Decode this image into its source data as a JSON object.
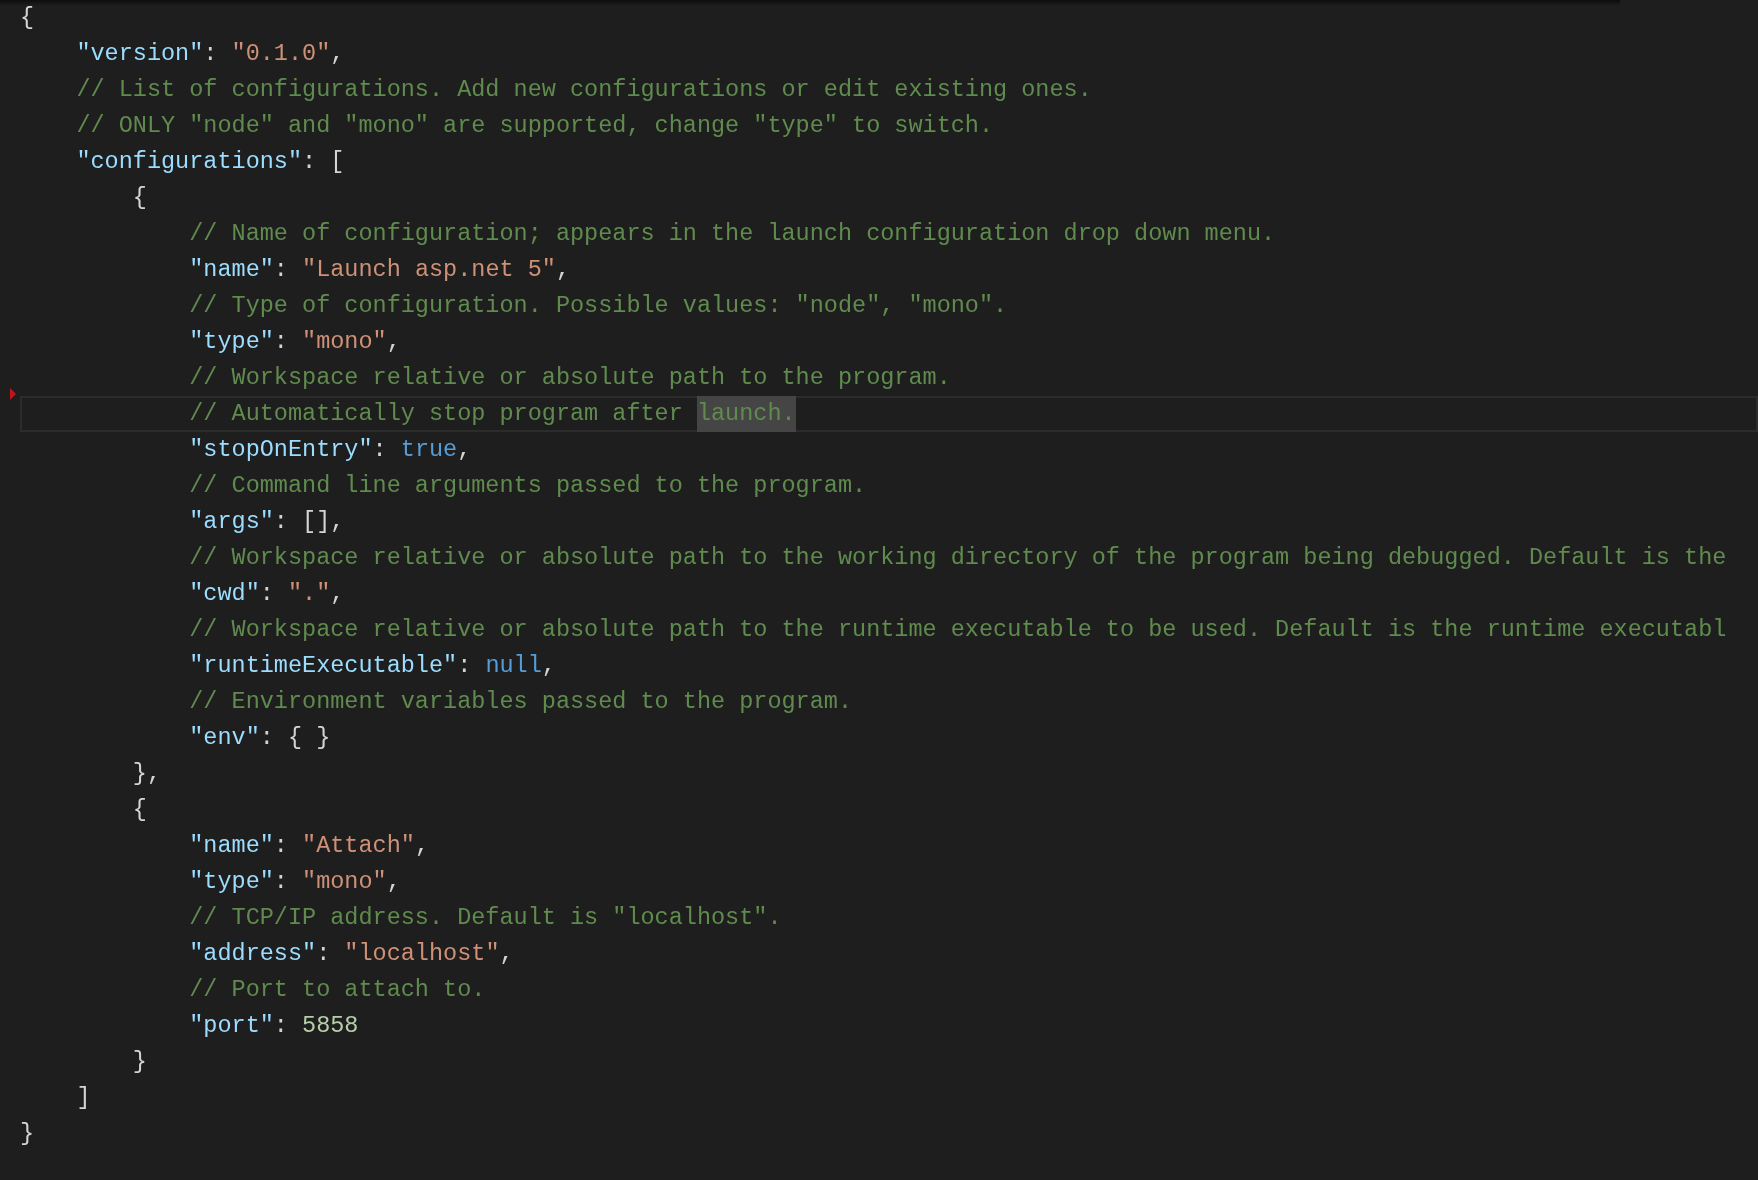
{
  "editor": {
    "lines": [
      {
        "current": false,
        "marker": false,
        "tokens": [
          {
            "kind": "punct",
            "text": "{",
            "highlighted": false
          }
        ],
        "children": [
          {
            "current": false,
            "marker": false,
            "tokens": [
              {
                "kind": "key",
                "text": "\"version\"",
                "highlighted": false
              },
              {
                "kind": "punct",
                "text": ": ",
                "highlighted": false
              },
              {
                "kind": "string",
                "text": "\"0.1.0\"",
                "highlighted": false
              },
              {
                "kind": "punct",
                "text": ",",
                "highlighted": false
              }
            ]
          },
          {
            "current": false,
            "marker": false,
            "tokens": [
              {
                "kind": "comment",
                "text": "// List of configurations. Add new configurations or edit existing ones.",
                "highlighted": false
              }
            ]
          },
          {
            "current": false,
            "marker": false,
            "tokens": [
              {
                "kind": "comment",
                "text": "// ONLY \"node\" and \"mono\" are supported, change \"type\" to switch.",
                "highlighted": false
              }
            ]
          },
          {
            "current": false,
            "marker": false,
            "tokens": [
              {
                "kind": "key",
                "text": "\"configurations\"",
                "highlighted": false
              },
              {
                "kind": "punct",
                "text": ": [",
                "highlighted": false
              }
            ],
            "children": [
              {
                "current": false,
                "marker": false,
                "tokens": [
                  {
                    "kind": "punct",
                    "text": "{",
                    "highlighted": false
                  }
                ],
                "children": [
                  {
                    "current": false,
                    "marker": false,
                    "tokens": [
                      {
                        "kind": "comment",
                        "text": "// Name of configuration; appears in the launch configuration drop down menu.",
                        "highlighted": false
                      }
                    ]
                  },
                  {
                    "current": false,
                    "marker": false,
                    "tokens": [
                      {
                        "kind": "key",
                        "text": "\"name\"",
                        "highlighted": false
                      },
                      {
                        "kind": "punct",
                        "text": ": ",
                        "highlighted": false
                      },
                      {
                        "kind": "string",
                        "text": "\"Launch asp.net 5\"",
                        "highlighted": false
                      },
                      {
                        "kind": "punct",
                        "text": ",",
                        "highlighted": false
                      }
                    ]
                  },
                  {
                    "current": false,
                    "marker": false,
                    "tokens": [
                      {
                        "kind": "comment",
                        "text": "// Type of configuration. Possible values: \"node\", \"mono\".",
                        "highlighted": false
                      }
                    ]
                  },
                  {
                    "current": false,
                    "marker": false,
                    "tokens": [
                      {
                        "kind": "key",
                        "text": "\"type\"",
                        "highlighted": false
                      },
                      {
                        "kind": "punct",
                        "text": ": ",
                        "highlighted": false
                      },
                      {
                        "kind": "string",
                        "text": "\"mono\"",
                        "highlighted": false
                      },
                      {
                        "kind": "punct",
                        "text": ",",
                        "highlighted": false
                      }
                    ]
                  },
                  {
                    "current": false,
                    "marker": false,
                    "tokens": [
                      {
                        "kind": "comment",
                        "text": "// Workspace relative or absolute path to the program.",
                        "highlighted": false
                      }
                    ]
                  },
                  {
                    "current": true,
                    "marker": true,
                    "tokens": [
                      {
                        "kind": "comment",
                        "text": "// Automatically stop program after",
                        "highlighted": false
                      },
                      {
                        "kind": "comment",
                        "text": "launch.",
                        "highlighted": true
                      }
                    ]
                  },
                  {
                    "current": false,
                    "marker": false,
                    "tokens": [
                      {
                        "kind": "key",
                        "text": "\"stopOnEntry\"",
                        "highlighted": false
                      },
                      {
                        "kind": "punct",
                        "text": ": ",
                        "highlighted": false
                      },
                      {
                        "kind": "keyword",
                        "text": "true",
                        "highlighted": false
                      },
                      {
                        "kind": "punct",
                        "text": ",",
                        "highlighted": false
                      }
                    ]
                  },
                  {
                    "current": false,
                    "marker": false,
                    "tokens": [
                      {
                        "kind": "comment",
                        "text": "// Command line arguments passed to the program.",
                        "highlighted": false
                      }
                    ]
                  },
                  {
                    "current": false,
                    "marker": false,
                    "tokens": [
                      {
                        "kind": "key",
                        "text": "\"args\"",
                        "highlighted": false
                      },
                      {
                        "kind": "punct",
                        "text": ": [],",
                        "highlighted": false
                      }
                    ]
                  },
                  {
                    "current": false,
                    "marker": false,
                    "tokens": [
                      {
                        "kind": "comment",
                        "text": "// Workspace relative or absolute path to the working directory of the program being debugged. Default is the",
                        "highlighted": false
                      }
                    ]
                  },
                  {
                    "current": false,
                    "marker": false,
                    "tokens": [
                      {
                        "kind": "key",
                        "text": "\"cwd\"",
                        "highlighted": false
                      },
                      {
                        "kind": "punct",
                        "text": ": ",
                        "highlighted": false
                      },
                      {
                        "kind": "string",
                        "text": "\".\"",
                        "highlighted": false
                      },
                      {
                        "kind": "punct",
                        "text": ",",
                        "highlighted": false
                      }
                    ]
                  },
                  {
                    "current": false,
                    "marker": false,
                    "tokens": [
                      {
                        "kind": "comment",
                        "text": "// Workspace relative or absolute path to the runtime executable to be used. Default is the runtime executabl",
                        "highlighted": false
                      }
                    ]
                  },
                  {
                    "current": false,
                    "marker": false,
                    "tokens": [
                      {
                        "kind": "key",
                        "text": "\"runtimeExecutable\"",
                        "highlighted": false
                      },
                      {
                        "kind": "punct",
                        "text": ": ",
                        "highlighted": false
                      },
                      {
                        "kind": "keyword",
                        "text": "null",
                        "highlighted": false
                      },
                      {
                        "kind": "punct",
                        "text": ",",
                        "highlighted": false
                      }
                    ]
                  },
                  {
                    "current": false,
                    "marker": false,
                    "tokens": [
                      {
                        "kind": "comment",
                        "text": "// Environment variables passed to the program.",
                        "highlighted": false
                      }
                    ]
                  },
                  {
                    "current": false,
                    "marker": false,
                    "tokens": [
                      {
                        "kind": "key",
                        "text": "\"env\"",
                        "highlighted": false
                      },
                      {
                        "kind": "punct",
                        "text": ": { }",
                        "highlighted": false
                      }
                    ]
                  }
                ]
              },
              {
                "current": false,
                "marker": false,
                "tokens": [
                  {
                    "kind": "punct",
                    "text": "},",
                    "highlighted": false
                  }
                ]
              },
              {
                "current": false,
                "marker": false,
                "tokens": [
                  {
                    "kind": "punct",
                    "text": "{",
                    "highlighted": false
                  }
                ],
                "children": [
                  {
                    "current": false,
                    "marker": false,
                    "tokens": [
                      {
                        "kind": "key",
                        "text": "\"name\"",
                        "highlighted": false
                      },
                      {
                        "kind": "punct",
                        "text": ": ",
                        "highlighted": false
                      },
                      {
                        "kind": "string",
                        "text": "\"Attach\"",
                        "highlighted": false
                      },
                      {
                        "kind": "punct",
                        "text": ",",
                        "highlighted": false
                      }
                    ]
                  },
                  {
                    "current": false,
                    "marker": false,
                    "tokens": [
                      {
                        "kind": "key",
                        "text": "\"type\"",
                        "highlighted": false
                      },
                      {
                        "kind": "punct",
                        "text": ": ",
                        "highlighted": false
                      },
                      {
                        "kind": "string",
                        "text": "\"mono\"",
                        "highlighted": false
                      },
                      {
                        "kind": "punct",
                        "text": ",",
                        "highlighted": false
                      }
                    ]
                  },
                  {
                    "current": false,
                    "marker": false,
                    "tokens": [
                      {
                        "kind": "comment",
                        "text": "// TCP/IP address. Default is \"localhost\".",
                        "highlighted": false
                      }
                    ]
                  },
                  {
                    "current": false,
                    "marker": false,
                    "tokens": [
                      {
                        "kind": "key",
                        "text": "\"address\"",
                        "highlighted": false
                      },
                      {
                        "kind": "punct",
                        "text": ": ",
                        "highlighted": false
                      },
                      {
                        "kind": "string",
                        "text": "\"localhost\"",
                        "highlighted": false
                      },
                      {
                        "kind": "punct",
                        "text": ",",
                        "highlighted": false
                      }
                    ]
                  },
                  {
                    "current": false,
                    "marker": false,
                    "tokens": [
                      {
                        "kind": "comment",
                        "text": "// Port to attach to.",
                        "highlighted": false
                      }
                    ]
                  },
                  {
                    "current": false,
                    "marker": false,
                    "tokens": [
                      {
                        "kind": "key",
                        "text": "\"port\"",
                        "highlighted": false
                      },
                      {
                        "kind": "punct",
                        "text": ": ",
                        "highlighted": false
                      },
                      {
                        "kind": "number",
                        "text": "5858",
                        "highlighted": false
                      }
                    ]
                  }
                ]
              },
              {
                "current": false,
                "marker": false,
                "tokens": [
                  {
                    "kind": "punct",
                    "text": "}",
                    "highlighted": false
                  }
                ]
              }
            ]
          },
          {
            "current": false,
            "marker": false,
            "tokens": [
              {
                "kind": "punct",
                "text": "]",
                "highlighted": false
              }
            ]
          }
        ]
      },
      {
        "current": false,
        "marker": false,
        "tokens": [
          {
            "kind": "punct",
            "text": "}",
            "highlighted": false
          }
        ]
      }
    ]
  }
}
